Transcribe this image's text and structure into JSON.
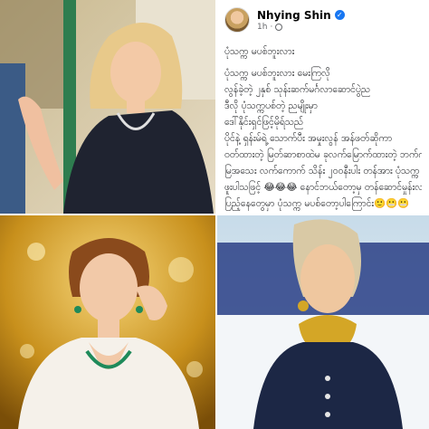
{
  "post": {
    "author": "Nhying Shin",
    "time": "1h",
    "separator": "·",
    "verified_icon": "verified-badge-icon",
    "privacy_icon": "globe-icon",
    "lines": [
      "ပုံသက္က မပစ်ဘူးလား",
      "ပုံသက္က မပစ်ဘူးလား မေးကြလို",
      "လွန်ခဲ့တဲ့ ၂နှစ် သုန်းဆက်မင်္ဂလာဆောင်ပွဲည",
      "ဒီလို ပုံသက္ကပစ်တဲ့ ညမျိုးမှာ",
      "ဒေါ်နိုင်းရှင်ဖြင့်မိုရ်သည်",
      "ပိုင်နဲ့ ရှန်းမ်ရဲ့ သောက်ပီး အမှုးလွန် အန်ဖတ်ဆိုကာ",
      "ဝတ်ထားတဲ့ မြတ်ဆာစာထဲမ ခုလက်မြောက်ထားတဲ့ ဘက်က",
      "မြအသေး လက်ကောက် သိန်း ၂၀၀နီးပါး တန်အား ပုံသက္က မပစ်ခဲ့",
      "ဖူးပါသဖြင့် 😂😂😂 နောင်ဘယ်တော့မှ တန်ဆောင်မှုန်းလ",
      "ပြည့်နေတွေမှာ ပုံသက္က မပစ်တော့ပါကြောင်း🙂😬😬"
    ]
  }
}
